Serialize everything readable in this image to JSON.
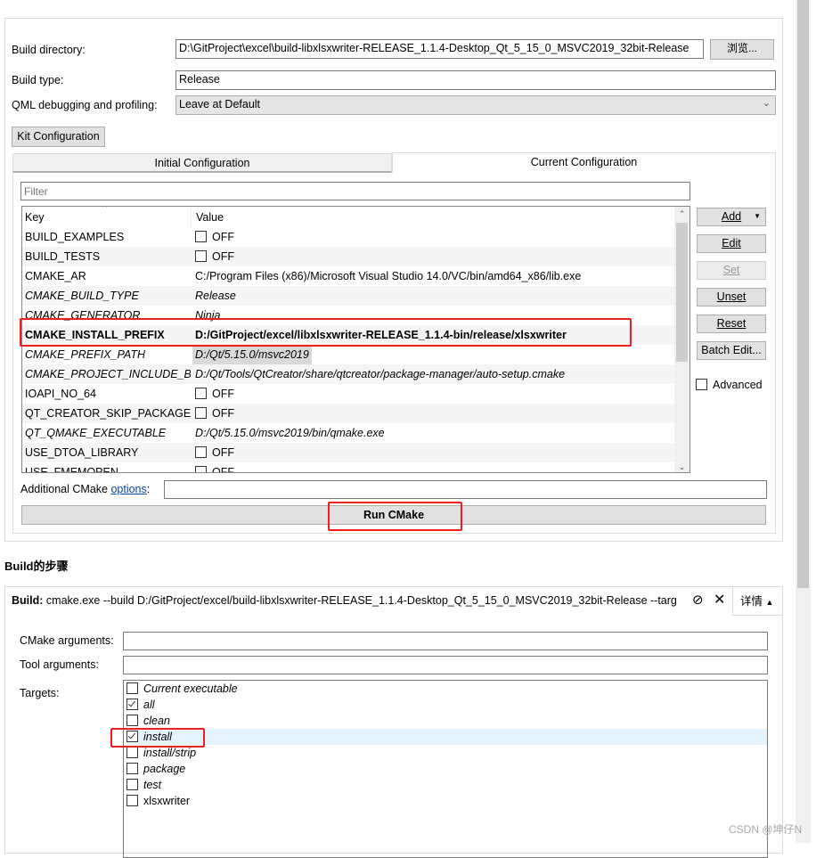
{
  "build_settings": {
    "build_directory_label": "Build directory:",
    "build_directory_value": "D:\\GitProject\\excel\\build-libxlsxwriter-RELEASE_1.1.4-Desktop_Qt_5_15_0_MSVC2019_32bit-Release",
    "browse_label": "浏览...",
    "build_type_label": "Build type:",
    "build_type_value": "Release",
    "qml_label": "QML debugging and profiling:",
    "qml_value": "Leave at Default",
    "kit_config_label": "Kit Configuration",
    "tabs": [
      {
        "label": "Initial Configuration",
        "active": false
      },
      {
        "label": "Current Configuration",
        "active": true
      }
    ],
    "filter_placeholder": "Filter",
    "table": {
      "headers": [
        "Key",
        "Value"
      ],
      "rows": [
        {
          "key": "BUILD_EXAMPLES",
          "value": "OFF",
          "checkbox": true,
          "style": "normal"
        },
        {
          "key": "BUILD_TESTS",
          "value": "OFF",
          "checkbox": true,
          "style": "normal"
        },
        {
          "key": "CMAKE_AR",
          "value": "C:/Program Files (x86)/Microsoft Visual Studio 14.0/VC/bin/amd64_x86/lib.exe",
          "style": "normal"
        },
        {
          "key": "CMAKE_BUILD_TYPE",
          "value": "Release",
          "style": "italic"
        },
        {
          "key": "CMAKE_GENERATOR",
          "value": "Ninja",
          "style": "italic"
        },
        {
          "key": "CMAKE_INSTALL_PREFIX",
          "value": "D:/GitProject/excel/libxlsxwriter-RELEASE_1.1.4-bin/release/xlsxwriter",
          "style": "bold"
        },
        {
          "key": "CMAKE_PREFIX_PATH",
          "value": "D:/Qt/5.15.0/msvc2019",
          "style": "italic",
          "selected": true
        },
        {
          "key": "CMAKE_PROJECT_INCLUDE_B...",
          "value": "D:/Qt/Tools/QtCreator/share/qtcreator/package-manager/auto-setup.cmake",
          "style": "italic"
        },
        {
          "key": "IOAPI_NO_64",
          "value": "OFF",
          "checkbox": true,
          "style": "normal"
        },
        {
          "key": "QT_CREATOR_SKIP_PACKAGE_...",
          "value": "OFF",
          "checkbox": true,
          "style": "normal"
        },
        {
          "key": "QT_QMAKE_EXECUTABLE",
          "value": "D:/Qt/5.15.0/msvc2019/bin/qmake.exe",
          "style": "italic"
        },
        {
          "key": "USE_DTOA_LIBRARY",
          "value": "OFF",
          "checkbox": true,
          "style": "normal"
        },
        {
          "key": "USE_FMEMOPEN",
          "value": "OFF",
          "checkbox": true,
          "style": "normal"
        }
      ]
    },
    "side_buttons": [
      {
        "label": "Add",
        "enabled": true,
        "dropdown": true
      },
      {
        "label": "Edit",
        "enabled": true
      },
      {
        "label": "Set",
        "enabled": false
      },
      {
        "label": "Unset",
        "enabled": true
      },
      {
        "label": "Reset",
        "enabled": true
      },
      {
        "label": "Batch Edit...",
        "enabled": true
      }
    ],
    "advanced_label": "Advanced",
    "additional_label": "Additional CMake ",
    "options_link": "options",
    "additional_suffix": ":",
    "run_cmake_label": "Run CMake"
  },
  "build_steps": {
    "heading": "Build的步骤",
    "step_prefix": "Build:",
    "step_command": "cmake.exe --build D:/GitProject/excel/build-libxlsxwriter-RELEASE_1.1.4-Desktop_Qt_5_15_0_MSVC2019_32bit-Release --targ",
    "details_label": "详情",
    "cmake_args_label": "CMake arguments:",
    "tool_args_label": "Tool arguments:",
    "targets_label": "Targets:",
    "targets": [
      {
        "name": "Current executable",
        "checked": false
      },
      {
        "name": "all",
        "checked": true
      },
      {
        "name": "clean",
        "checked": false
      },
      {
        "name": "install",
        "checked": true,
        "highlighted": true
      },
      {
        "name": "install/strip",
        "checked": false
      },
      {
        "name": "package",
        "checked": false
      },
      {
        "name": "test",
        "checked": false
      },
      {
        "name": "xlsxwriter",
        "checked": false,
        "italic": false
      }
    ]
  },
  "watermark": "CSDN @坤仔N",
  "colors": {
    "highlight_box": "#f21d1d",
    "link": "#0645ad",
    "selected_row": "#e5f3ff"
  }
}
